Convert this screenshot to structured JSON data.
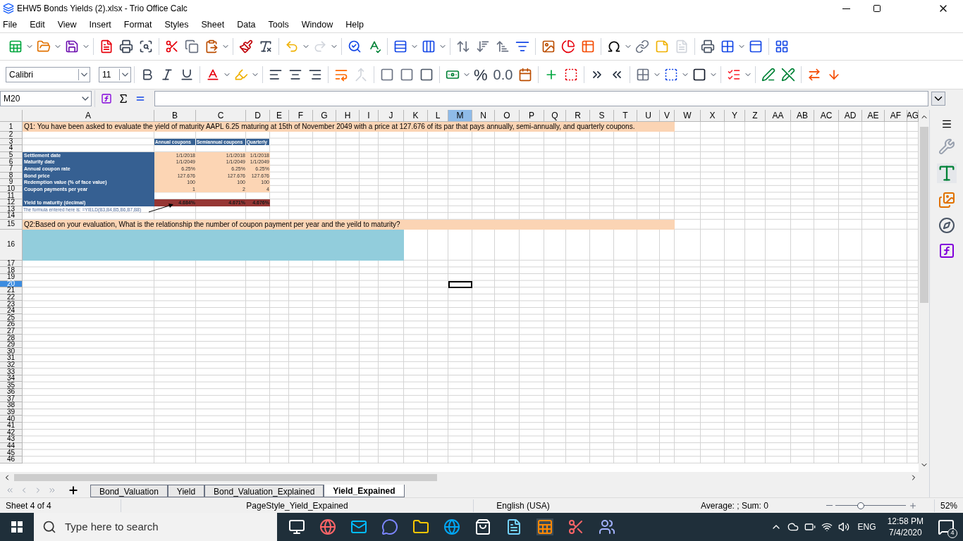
{
  "window": {
    "title": "EHW5 Bonds  Yields (2).xlsx - Trio Office Calc"
  },
  "menu": [
    "File",
    "Edit",
    "View",
    "Insert",
    "Format",
    "Styles",
    "Sheet",
    "Data",
    "Tools",
    "Window",
    "Help"
  ],
  "formatting": {
    "font_name": "Calibri",
    "font_size": "11",
    "percent": "%",
    "decimal": "0.0"
  },
  "formula_bar": {
    "name_box": "M20"
  },
  "sheet": {
    "columns": [
      {
        "label": "A",
        "selected": false
      },
      {
        "label": "B",
        "selected": false
      },
      {
        "label": "C",
        "selected": false
      },
      {
        "label": "D",
        "selected": false
      },
      {
        "label": "E",
        "selected": false
      },
      {
        "label": "F",
        "selected": false
      },
      {
        "label": "G",
        "selected": false
      },
      {
        "label": "H",
        "selected": false
      },
      {
        "label": "I",
        "selected": false
      },
      {
        "label": "J",
        "selected": false
      },
      {
        "label": "K",
        "selected": false
      },
      {
        "label": "L",
        "selected": false
      },
      {
        "label": "M",
        "selected": true
      },
      {
        "label": "N",
        "selected": false
      },
      {
        "label": "O",
        "selected": false
      },
      {
        "label": "P",
        "selected": false
      },
      {
        "label": "Q",
        "selected": false
      },
      {
        "label": "R",
        "selected": false
      },
      {
        "label": "S",
        "selected": false
      },
      {
        "label": "T",
        "selected": false
      },
      {
        "label": "U",
        "selected": false
      },
      {
        "label": "V",
        "selected": false
      },
      {
        "label": "W",
        "selected": false
      },
      {
        "label": "X",
        "selected": false
      },
      {
        "label": "Y",
        "selected": false
      },
      {
        "label": "Z",
        "selected": false
      },
      {
        "label": "AA",
        "selected": false
      },
      {
        "label": "AB",
        "selected": false
      },
      {
        "label": "AC",
        "selected": false
      },
      {
        "label": "AD",
        "selected": false
      },
      {
        "label": "AE",
        "selected": false
      },
      {
        "label": "AF",
        "selected": false
      },
      {
        "label": "AG",
        "selected": false
      }
    ],
    "rows": [
      {
        "label": "1",
        "selected": false,
        "kind": "question",
        "cells": [
          "Q1: You have been asked to evaluate the yield of maturity AAPL 6.25 maturing at 15th of November 2049 with a price at 127.676 of its par that pays annually, semi-annually, and quarterly coupons."
        ]
      },
      {
        "label": "2",
        "selected": false,
        "kind": "plain"
      },
      {
        "label": "3",
        "selected": false,
        "kind": "header",
        "cells": [
          "Annual coupons",
          "Semiannual coupons",
          "Quarterly"
        ]
      },
      {
        "label": "4",
        "selected": false,
        "kind": "plain"
      },
      {
        "label": "5",
        "selected": false,
        "kind": "data",
        "cells": [
          "Settlement date",
          "1/1/2018",
          "1/1/2018",
          "1/1/2018"
        ]
      },
      {
        "label": "6",
        "selected": false,
        "kind": "data",
        "cells": [
          "Maturity date",
          "1/1/2049",
          "1/1/2049",
          "1/1/2049"
        ]
      },
      {
        "label": "7",
        "selected": false,
        "kind": "data",
        "cells": [
          "Annual coupon rate",
          "6.25%",
          "6.25%",
          "6.25%"
        ]
      },
      {
        "label": "8",
        "selected": false,
        "kind": "data",
        "cells": [
          "Bond price",
          "127.676",
          "127.676",
          "127.676"
        ]
      },
      {
        "label": "9",
        "selected": false,
        "kind": "data",
        "cells": [
          "Redemption value (% of face value)",
          "100",
          "100",
          "100"
        ]
      },
      {
        "label": "10",
        "selected": false,
        "kind": "data",
        "cells": [
          "Coupon payments per year",
          "1",
          "2",
          "4"
        ]
      },
      {
        "label": "11",
        "selected": false,
        "kind": "spacer"
      },
      {
        "label": "12",
        "selected": false,
        "kind": "result",
        "cells": [
          "Yield to maturity (decimal)",
          "4.684%",
          "4.671%",
          "4.676%"
        ]
      },
      {
        "label": "13",
        "selected": false,
        "kind": "note",
        "cells": [
          "The formula entered here is: =YIELD(B3,B4,B5,B6,B7,B8)"
        ]
      },
      {
        "label": "14",
        "selected": false,
        "kind": "plain"
      },
      {
        "label": "15",
        "selected": false,
        "kind": "question",
        "cells": [
          "Q2:Based on your evaluation, What is the relationship the number of coupon payment per year and the yeild to maturity?"
        ]
      },
      {
        "label": "16",
        "selected": false,
        "kind": "answer"
      },
      {
        "label": "17",
        "selected": false,
        "kind": "plain"
      },
      {
        "label": "18",
        "selected": false,
        "kind": "plain"
      },
      {
        "label": "19",
        "selected": false,
        "kind": "plain"
      },
      {
        "label": "20",
        "selected": true,
        "kind": "plain"
      },
      {
        "label": "21",
        "selected": false,
        "kind": "plain"
      },
      {
        "label": "22",
        "selected": false,
        "kind": "plain"
      },
      {
        "label": "23",
        "selected": false,
        "kind": "plain"
      },
      {
        "label": "24",
        "selected": false,
        "kind": "plain"
      },
      {
        "label": "25",
        "selected": false,
        "kind": "plain"
      },
      {
        "label": "26",
        "selected": false,
        "kind": "plain"
      },
      {
        "label": "27",
        "selected": false,
        "kind": "plain"
      },
      {
        "label": "28",
        "selected": false,
        "kind": "plain"
      },
      {
        "label": "29",
        "selected": false,
        "kind": "plain"
      },
      {
        "label": "30",
        "selected": false,
        "kind": "plain"
      },
      {
        "label": "31",
        "selected": false,
        "kind": "plain"
      },
      {
        "label": "32",
        "selected": false,
        "kind": "plain"
      },
      {
        "label": "33",
        "selected": false,
        "kind": "plain"
      },
      {
        "label": "34",
        "selected": false,
        "kind": "plain"
      },
      {
        "label": "35",
        "selected": false,
        "kind": "plain"
      },
      {
        "label": "36",
        "selected": false,
        "kind": "plain"
      },
      {
        "label": "37",
        "selected": false,
        "kind": "plain"
      },
      {
        "label": "38",
        "selected": false,
        "kind": "plain"
      },
      {
        "label": "39",
        "selected": false,
        "kind": "plain"
      },
      {
        "label": "40",
        "selected": false,
        "kind": "plain"
      },
      {
        "label": "41",
        "selected": false,
        "kind": "plain"
      },
      {
        "label": "42",
        "selected": false,
        "kind": "plain"
      },
      {
        "label": "43",
        "selected": false,
        "kind": "plain"
      },
      {
        "label": "44",
        "selected": false,
        "kind": "plain"
      },
      {
        "label": "45",
        "selected": false,
        "kind": "plain"
      },
      {
        "label": "46",
        "selected": false,
        "kind": "plain"
      }
    ]
  },
  "sheet_tabs": [
    {
      "label": "Bond_Valuation",
      "selected": false
    },
    {
      "label": "Yield",
      "selected": false
    },
    {
      "label": "Bond_Valuation_Explained",
      "selected": false
    },
    {
      "label": "Yield_Expained",
      "selected": true
    }
  ],
  "status_bar": {
    "sheet": "Sheet 4 of 4",
    "page_style": "PageStyle_Yield_Expained",
    "language": "English (USA)",
    "summary": "Average: ; Sum: 0",
    "zoom": {
      "level": 0.36
    },
    "zoom_text": "52%"
  },
  "taskbar": {
    "search_placeholder": "Type here to search",
    "language": "ENG",
    "time": "12:58 PM",
    "date": "7/4/2020",
    "notifications": "4"
  }
}
